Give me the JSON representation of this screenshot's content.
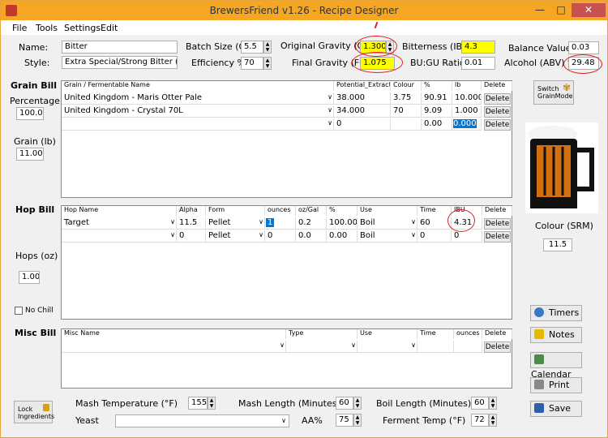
{
  "titlebar": {
    "title": "BrewersFriend v1.26 - Recipe Designer",
    "min_label": "—",
    "max_label": "□",
    "close_label": "✕"
  },
  "menu": {
    "file": "File",
    "tools": "Tools",
    "settings": "Settings",
    "edit": "Edit"
  },
  "recipe": {
    "name_label": "Name:",
    "name_value": "Bitter",
    "style_label": "Style:",
    "style_value": "Extra Special/Strong Bitter (ES",
    "batch_label": "Batch Size (G)",
    "batch_value": "5.5",
    "efficiency_label": "Efficiency %",
    "efficiency_value": "70",
    "og_label": "Original Gravity (OG)",
    "og_value": "1.300",
    "fg_label": "Final Gravity (FG)",
    "fg_value": "1.075",
    "ibu_label": "Bitterness (IBU)",
    "ibu_value": "4.3",
    "bugu_label": "BU:GU Ratio",
    "bugu_value": "0.01",
    "balance_label": "Balance Value",
    "balance_value": "0.03",
    "abv_label": "Alcohol (ABV) %",
    "abv_value": "29.48"
  },
  "grain": {
    "section_label": "Grain Bill",
    "percentage_label": "Percentage",
    "percentage_value": "100.00",
    "grain_lb_label": "Grain (lb)",
    "grain_lb_value": "11.000",
    "headers": [
      "Grain / Fermentable Name",
      "Potential_Extract",
      "Colour",
      "%",
      "lb",
      "Delete"
    ],
    "rows": [
      {
        "name": "United Kingdom - Maris Otter Pale",
        "extract": "38.000",
        "colour": "3.75",
        "pct": "90.91",
        "lb": "10.000",
        "del": "Delete"
      },
      {
        "name": "United Kingdom - Crystal 70L",
        "extract": "34.000",
        "colour": "70",
        "pct": "9.09",
        "lb": "1.000",
        "del": "Delete"
      },
      {
        "name": "",
        "extract": "0",
        "colour": "",
        "pct": "0.00",
        "lb": "0.000",
        "del": "Delete"
      }
    ]
  },
  "switch_button": {
    "line1": "Switch",
    "line2": "GrainMode"
  },
  "srm": {
    "label": "Colour (SRM)",
    "value": "11.5"
  },
  "hop": {
    "section_label": "Hop Bill",
    "hops_oz_label": "Hops (oz)",
    "hops_oz_value": "1.00",
    "nochill_label": "No Chill",
    "headers": [
      "Hop Name",
      "Alpha",
      "Form",
      "ounces",
      "oz/Gal",
      "%",
      "Use",
      "Time",
      "IBU",
      "Delete"
    ],
    "rows": [
      {
        "name": "Target",
        "alpha": "11.5",
        "form": "Pellet",
        "oz": "1",
        "ozgal": "0.2",
        "pct": "100.00",
        "use": "Boil",
        "time": "60",
        "ibu": "4.31",
        "del": "Delete"
      },
      {
        "name": "",
        "alpha": "0",
        "form": "Pellet",
        "oz": "0",
        "ozgal": "0.0",
        "pct": "0.00",
        "use": "Boil",
        "time": "0",
        "ibu": "0",
        "del": "Delete"
      }
    ]
  },
  "misc": {
    "section_label": "Misc Bill",
    "headers": [
      "Misc Name",
      "Type",
      "Use",
      "Time",
      "ounces",
      "Delete"
    ],
    "rows": [
      {
        "name": "",
        "type": "",
        "use": "",
        "time": "",
        "oz": "",
        "del": "Delete"
      }
    ]
  },
  "sidebuttons": {
    "timers": "Timers",
    "notes": "Notes",
    "calendar": "Calendar",
    "print": "Print",
    "save": "Save"
  },
  "bottom": {
    "lock_line1": "Lock",
    "lock_line2": "Ingredients",
    "mash_temp_label": "Mash Temperature (°F)",
    "mash_temp_value": "155",
    "mash_len_label": "Mash Length (Minutes)",
    "mash_len_value": "60",
    "boil_len_label": "Boil Length (Minutes)",
    "boil_len_value": "60",
    "yeast_label": "Yeast",
    "yeast_value": "",
    "aa_label": "AA%",
    "aa_value": "75",
    "ferment_label": "Ferment Temp (°F)",
    "ferment_value": "72"
  },
  "colors": {
    "titlebar": "#f5a623",
    "highlight": "#ffff00",
    "selection": "#0078d7",
    "annotation": "#e02020",
    "beer": "#d46f0f"
  }
}
